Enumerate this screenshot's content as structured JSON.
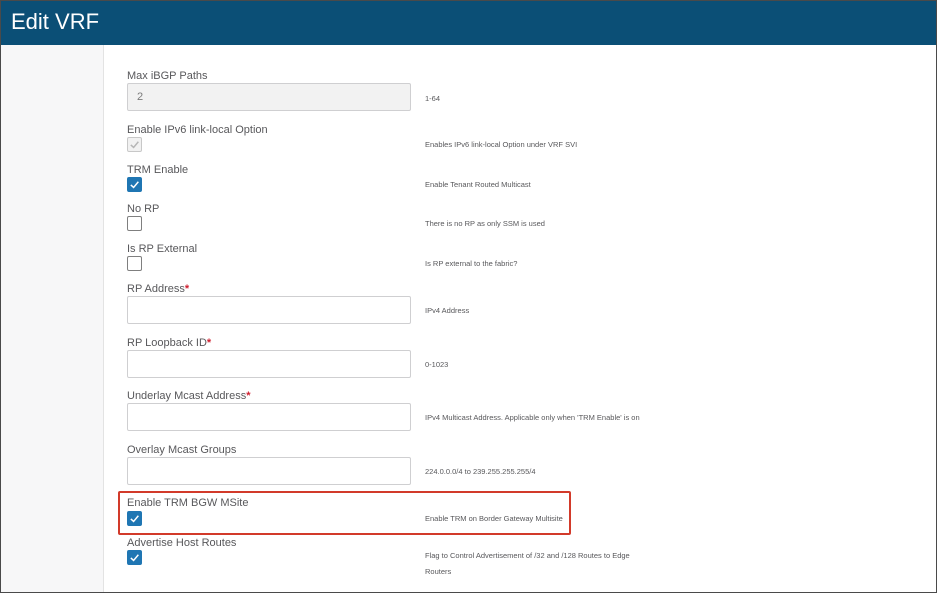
{
  "window": {
    "title": "Edit VRF"
  },
  "colors": {
    "header": "#0b4f76",
    "checkbox_checked": "#1f76b3",
    "required": "#cf2030",
    "highlight": "#d23a2a"
  },
  "fields": {
    "max_ibgp_paths": {
      "label": "Max iBGP Paths",
      "value": "2",
      "hint": "1-64"
    },
    "ipv6_link_local": {
      "label": "Enable IPv6 link-local Option",
      "checked": true,
      "disabled": true,
      "hint": "Enables IPv6 link-local Option under VRF SVI"
    },
    "trm_enable": {
      "label": "TRM Enable",
      "checked": true,
      "hint": "Enable Tenant Routed Multicast"
    },
    "no_rp": {
      "label": "No RP",
      "checked": false,
      "hint": "There is no RP as only SSM is used"
    },
    "is_rp_external": {
      "label": "Is RP External",
      "checked": false,
      "hint": "Is RP external to the fabric?"
    },
    "rp_address": {
      "label": "RP Address",
      "required_mark": "*",
      "value": "",
      "hint": "IPv4 Address"
    },
    "rp_loopback_id": {
      "label": "RP Loopback ID",
      "required_mark": "*",
      "value": "",
      "hint": "0-1023"
    },
    "underlay_mcast_address": {
      "label": "Underlay Mcast Address",
      "required_mark": "*",
      "value": "",
      "hint": "IPv4 Multicast Address. Applicable only when 'TRM Enable' is on"
    },
    "overlay_mcast_groups": {
      "label": "Overlay Mcast Groups",
      "value": "",
      "hint": "224.0.0.0/4 to 239.255.255.255/4"
    },
    "enable_trm_bgw_msite": {
      "label": "Enable TRM BGW MSite",
      "checked": true,
      "hint": "Enable TRM on Border Gateway Multisite"
    },
    "advertise_host_routes": {
      "label": "Advertise Host Routes",
      "checked": true,
      "hint": "Flag to Control Advertisement of /32 and /128 Routes to Edge Routers"
    }
  }
}
